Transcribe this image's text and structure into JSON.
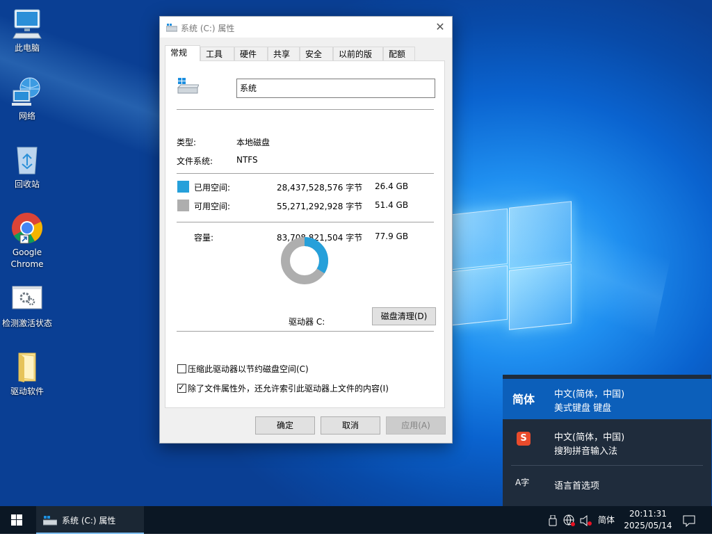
{
  "desktop": {
    "icons": [
      {
        "label": "此电脑"
      },
      {
        "label": "网络"
      },
      {
        "label": "回收站"
      },
      {
        "label": "Google Chrome"
      },
      {
        "label": "检测激活状态"
      },
      {
        "label": "驱动软件"
      }
    ]
  },
  "window": {
    "title": "系统 (C:) 属性",
    "close_glyph": "✕",
    "tabs": [
      "常规",
      "工具",
      "硬件",
      "共享",
      "安全",
      "以前的版本",
      "配额"
    ],
    "active_tab": 0,
    "drive_name": "系统",
    "type_label": "类型:",
    "type_value": "本地磁盘",
    "fs_label": "文件系统:",
    "fs_value": "NTFS",
    "used_label": "已用空间:",
    "used_bytes": "28,437,528,576 字节",
    "used_size": "26.4 GB",
    "free_label": "可用空间:",
    "free_bytes": "55,271,292,928 字节",
    "free_size": "51.4 GB",
    "capacity_label": "容量:",
    "capacity_bytes": "83,708,821,504 字节",
    "capacity_size": "77.9 GB",
    "used_fraction": 0.34,
    "drive_label": "驱动器 C:",
    "cleanup_button": "磁盘清理(D)",
    "compress_label": "压缩此驱动器以节约磁盘空间(C)",
    "compress_checked": false,
    "index_label": "除了文件属性外，还允许索引此驱动器上文件的内容(I)",
    "index_checked": true,
    "ok_button": "确定",
    "cancel_button": "取消",
    "apply_button": "应用(A)",
    "colors": {
      "used": "#26a0da",
      "free": "#aeaeae"
    }
  },
  "language_flyout": {
    "items": [
      {
        "abbr": "简体",
        "line1": "中文(简体，中国)",
        "line2": "美式键盘 键盘",
        "selected": true
      },
      {
        "abbr": "S",
        "line1": "中文(简体，中国)",
        "line2": "搜狗拼音输入法",
        "selected": false
      }
    ],
    "prefs_label": "语言首选项",
    "prefs_icon_text": "A字"
  },
  "taskbar": {
    "app_label": "系统 (C:) 属性",
    "ime_indicator": "简体",
    "time": "20:11:31",
    "date": "2025/05/14"
  }
}
